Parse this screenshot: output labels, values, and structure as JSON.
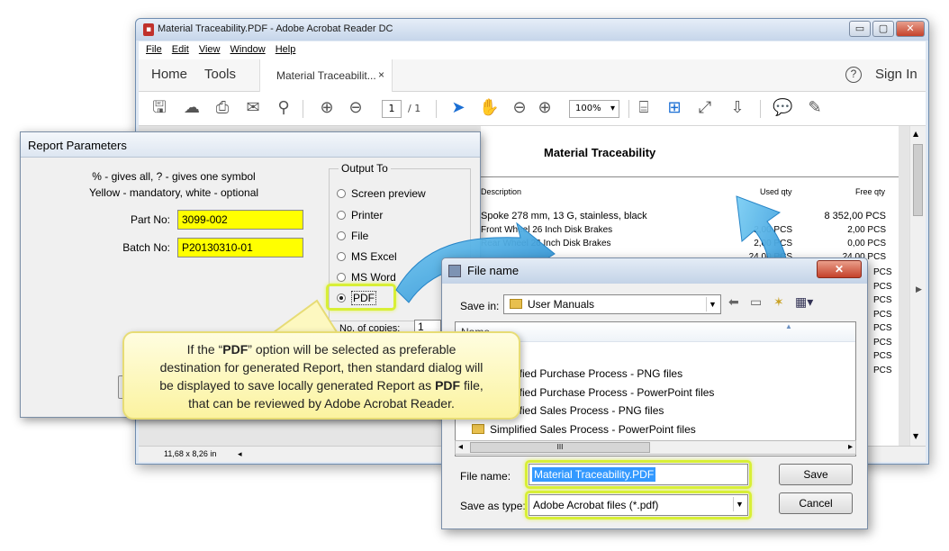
{
  "acrobat": {
    "title": "Material Traceability.PDF - Adobe Acrobat Reader DC",
    "app_icon": "pdf-icon",
    "window_controls": {
      "minimize": "▭",
      "maximize": "▢",
      "close": "✕"
    },
    "menu": [
      "File",
      "Edit",
      "View",
      "Window",
      "Help"
    ],
    "tabs": {
      "home": "Home",
      "tools": "Tools",
      "doc_tab": "Material Traceabilit...",
      "doc_tab_close": "×",
      "help": "?",
      "sign_in": "Sign In"
    },
    "toolbar": {
      "icons": [
        "save-icon",
        "upload-icon",
        "print-icon",
        "email-icon",
        "search-icon",
        "page-up-icon",
        "page-down-icon",
        "select-cursor-icon",
        "hand-tool-icon",
        "zoom-out-icon",
        "zoom-in-icon",
        "fit-page-icon",
        "fit-width-icon",
        "full-screen-icon",
        "scroll-mode-icon",
        "comment-icon",
        "sign-icon"
      ],
      "page_current": "1",
      "page_total": "/ 1",
      "zoom": "100%",
      "zoom_dropdown": "▾"
    },
    "document": {
      "title": "Material Traceability",
      "headers": {
        "description": "Description",
        "used_qty": "Used qty",
        "free_qty": "Free qty"
      },
      "rows": [
        {
          "description": "Spoke 278 mm, 13 G, stainless, black",
          "used": "",
          "free": "8 352,00 PCS"
        },
        {
          "description": "Front Wheel 26 Inch Disk Brakes",
          "used": "2,00 PCS",
          "free": "2,00 PCS"
        },
        {
          "description": "Rear Wheel 26 Inch Disk Brakes",
          "used": "2,00 PCS",
          "free": "0,00 PCS"
        },
        {
          "description": "",
          "used": "24,00 PCS",
          "free": "24,00 PCS"
        }
      ],
      "side_units": [
        "PCS",
        "PCS",
        "PCS",
        "PCS",
        "PCS",
        "PCS",
        "PCS",
        "PCS"
      ]
    },
    "status": {
      "page_size": "11,68 x 8,26 in"
    }
  },
  "report": {
    "title": "Report Parameters",
    "hint_line1": "% - gives all, ? - gives one symbol",
    "hint_line2": "Yellow - mandatory, white - optional",
    "part_no_label": "Part No:",
    "part_no_value": "3099-002",
    "batch_no_label": "Batch No:",
    "batch_no_value": "P20130310-01",
    "output_to": "Output To",
    "options": [
      "Screen preview",
      "Printer",
      "File",
      "MS Excel",
      "MS Word",
      "PDF"
    ],
    "selected_option": "PDF",
    "copies_label": "No. of copies:",
    "copies_value": "1"
  },
  "file_dialog": {
    "title": "File name",
    "close": "✕",
    "save_in_label": "Save in:",
    "save_in_value": "User Manuals",
    "name_header": "Name",
    "files": [
      "Simplified Purchase Process - PNG files",
      "Simplified Purchase Process - PowerPoint files",
      "Simplified Sales Process - PNG files",
      "Simplified Sales Process - PowerPoint files"
    ],
    "scroll_thumb": "III",
    "file_name_label": "File name:",
    "file_name_value": "Material Traceability.PDF",
    "save_type_label": "Save as type:",
    "save_type_value": "Adobe Acrobat files (*.pdf)",
    "save_button": "Save",
    "cancel_button": "Cancel"
  },
  "callout": {
    "line1_prefix": "If the “",
    "line1_bold": "PDF",
    "line1_suffix": "” option will be selected as preferable",
    "line2": "destination for generated Report, then standard dialog will",
    "line3_prefix": "be displayed to save locally generated Report as ",
    "line3_bold": "PDF",
    "line3_suffix": " file,",
    "line4": "that can be reviewed by Adobe Acrobat Reader."
  },
  "colors": {
    "mandatory_field": "#ffff00",
    "highlight": "#d8ef36",
    "arrow": "#2e9fdb"
  }
}
